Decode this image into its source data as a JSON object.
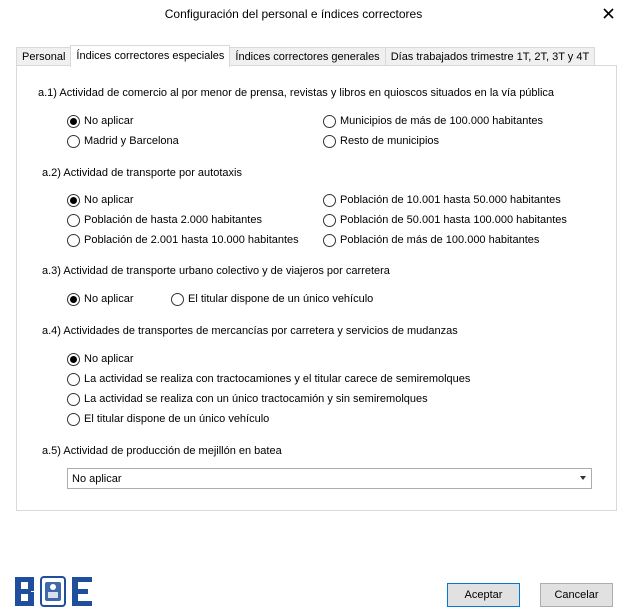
{
  "window": {
    "title": "Configuración del personal e índices correctores"
  },
  "tabs": [
    {
      "label": "Personal",
      "active": false
    },
    {
      "label": "Índices correctores especiales",
      "active": true
    },
    {
      "label": "Índices correctores generales",
      "active": false
    },
    {
      "label": "Días trabajados trimestre 1T, 2T, 3T y 4T",
      "active": false
    }
  ],
  "sections": {
    "a1": {
      "title": "a.1) Actividad de comercio al por menor de prensa, revistas y libros en quioscos situados en la vía pública",
      "options": [
        {
          "label": "No aplicar",
          "checked": true
        },
        {
          "label": "Madrid y Barcelona",
          "checked": false
        },
        {
          "label": "Municipios de más de 100.000 habitantes",
          "checked": false
        },
        {
          "label": "Resto de municipios",
          "checked": false
        }
      ]
    },
    "a2": {
      "title": "a.2) Actividad de transporte por autotaxis",
      "options": [
        {
          "label": "No aplicar",
          "checked": true
        },
        {
          "label": "Población de hasta 2.000 habitantes",
          "checked": false
        },
        {
          "label": "Población de 2.001 hasta 10.000 habitantes",
          "checked": false
        },
        {
          "label": "Población de 10.001 hasta 50.000 habitantes",
          "checked": false
        },
        {
          "label": "Población de 50.001 hasta 100.000 habitantes",
          "checked": false
        },
        {
          "label": "Población de más de 100.000 habitantes",
          "checked": false
        }
      ]
    },
    "a3": {
      "title": "a.3) Actividad de transporte urbano colectivo y de viajeros por carretera",
      "options": [
        {
          "label": "No aplicar",
          "checked": true
        },
        {
          "label": "El titular dispone de un único vehículo",
          "checked": false
        }
      ]
    },
    "a4": {
      "title": "a.4) Actividades de transportes de mercancías por carretera y servicios de mudanzas",
      "options": [
        {
          "label": "No aplicar",
          "checked": true
        },
        {
          "label": "La actividad se realiza con tractocamiones y el titular carece de semiremolques",
          "checked": false
        },
        {
          "label": "La actividad se realiza con un único tractocamión y sin semiremolques",
          "checked": false
        },
        {
          "label": "El titular dispone de un único vehículo",
          "checked": false
        }
      ]
    },
    "a5": {
      "title": "a.5) Actividad de producción de mejillón en batea",
      "select_value": "No aplicar"
    }
  },
  "footer": {
    "logo_icon": "boe-logo",
    "accept_label": "Aceptar",
    "cancel_label": "Cancelar"
  },
  "colors": {
    "accent": "#0078d7",
    "logo_blue": "#1f4e9c"
  }
}
